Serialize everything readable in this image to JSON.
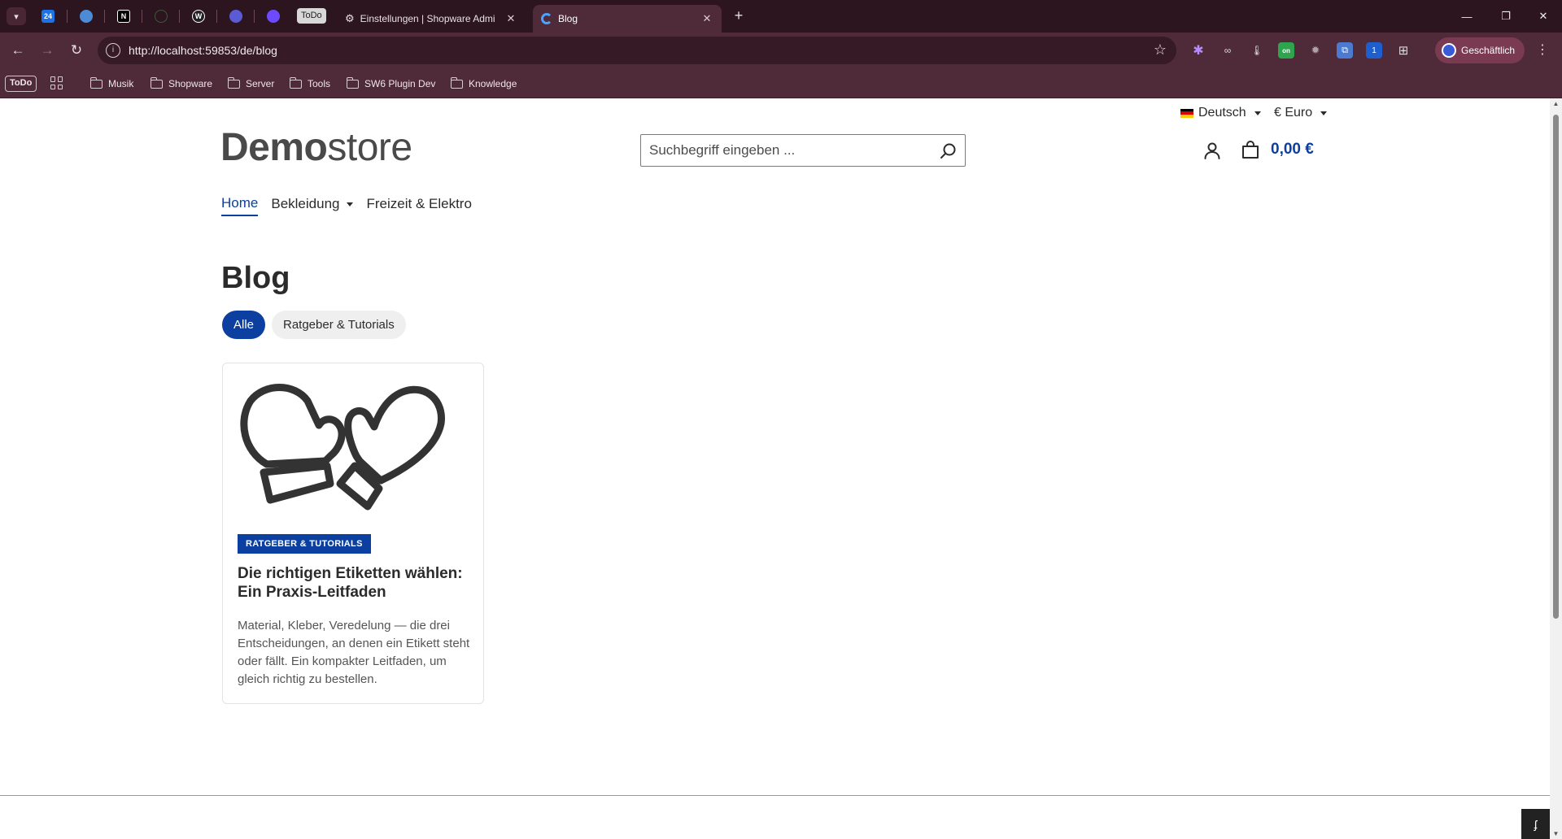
{
  "browser": {
    "pinned_tabs": [
      {
        "icon": "calendar-24-icon",
        "label": "24",
        "color": "#1a73e8"
      },
      {
        "icon": "app-icon",
        "label": "",
        "color": "#4c8bd6"
      },
      {
        "icon": "notion-icon",
        "label": "N",
        "color": "#000000"
      },
      {
        "icon": "github-icon",
        "label": "",
        "color": "#2d1520"
      },
      {
        "icon": "w-icon",
        "label": "W",
        "color": "#222222"
      },
      {
        "icon": "proton-icon",
        "label": "",
        "color": "#5b5bd6"
      },
      {
        "icon": "purple-app-icon",
        "label": "",
        "color": "#6d4aff"
      }
    ],
    "todo_tab_label": "ToDo",
    "tabs": [
      {
        "title": "Einstellungen | Shopware Admi",
        "close": "✕"
      },
      {
        "title": "Blog",
        "close": "✕"
      }
    ],
    "new_tab": "+",
    "window_controls": {
      "minimize": "—",
      "restore": "❐",
      "close": "✕"
    },
    "url": "http://localhost:59853/de/blog",
    "profile_label": "Geschäftlich",
    "bookmarks": {
      "todo": "ToDo",
      "folders": [
        "Musik",
        "Shopware",
        "Server",
        "Tools",
        "SW6 Plugin Dev",
        "Knowledge"
      ]
    }
  },
  "store": {
    "language": "Deutsch",
    "currency": "€ Euro",
    "logo_bold": "Demo",
    "logo_light": "store",
    "search_placeholder": "Suchbegriff eingeben ...",
    "cart_total": "0,00 €",
    "nav": [
      {
        "label": "Home",
        "active": true
      },
      {
        "label": "Bekleidung",
        "dropdown": true
      },
      {
        "label": "Freizeit & Elektro"
      }
    ],
    "accent_color": "#0b3fa0"
  },
  "blog": {
    "title": "Blog",
    "filters": [
      {
        "label": "Alle",
        "active": true
      },
      {
        "label": "Ratgeber & Tutorials",
        "active": false
      }
    ],
    "posts": [
      {
        "image_icon": "mittens-icon",
        "category": "RATGEBER & TUTORIALS",
        "title": "Die richtigen Etiketten wählen: Ein Praxis-Leitfaden",
        "excerpt": "Material, Kleber, Veredelung — die drei Entscheidungen, an denen ein Etikett steht oder fällt. Ein kompakter Leitfaden, um gleich richtig zu bestellen."
      }
    ]
  }
}
